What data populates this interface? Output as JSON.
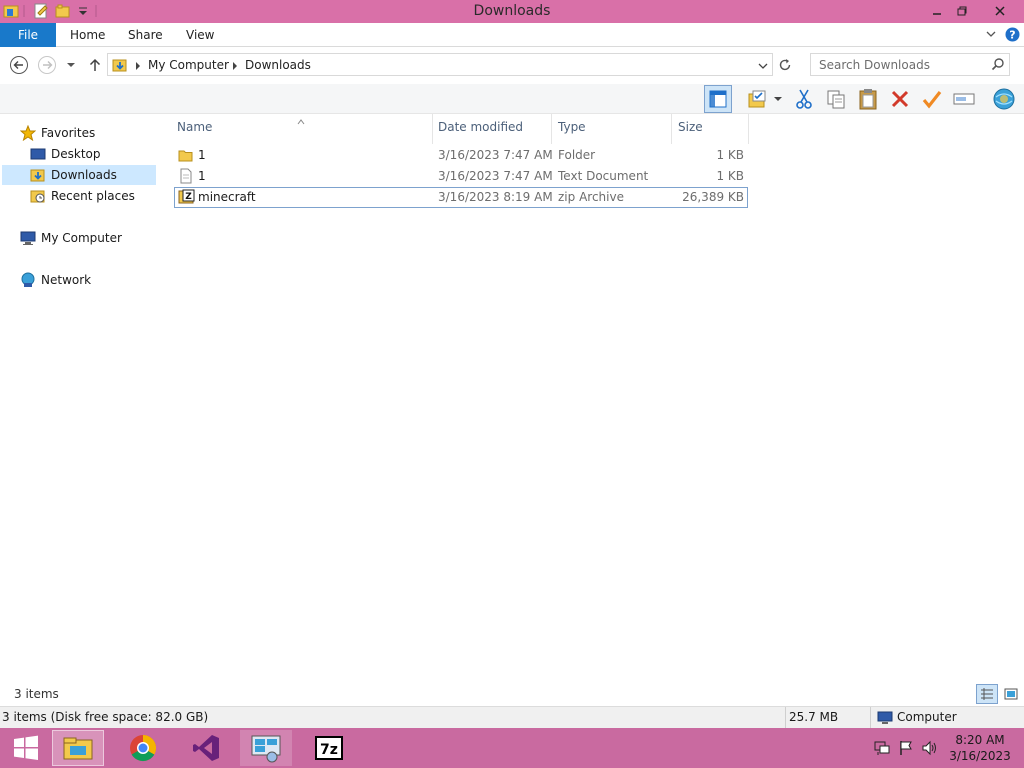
{
  "window": {
    "title": "Downloads"
  },
  "ribbon": {
    "tabs": [
      "File",
      "Home",
      "Share",
      "View"
    ]
  },
  "address": {
    "crumbs": [
      "My Computer",
      "Downloads"
    ],
    "search_placeholder": "Search Downloads"
  },
  "navpane": {
    "items": [
      {
        "label": "Favorites",
        "icon": "star-icon"
      },
      {
        "label": "Desktop",
        "icon": "desktop-icon"
      },
      {
        "label": "Downloads",
        "icon": "downloads-folder-icon",
        "selected": true
      },
      {
        "label": "Recent places",
        "icon": "recent-places-icon"
      },
      {
        "label": "My Computer",
        "icon": "computer-icon"
      },
      {
        "label": "Network",
        "icon": "network-icon"
      }
    ]
  },
  "columns": [
    "Name",
    "Date modified",
    "Type",
    "Size"
  ],
  "files": [
    {
      "name": "1",
      "date": "3/16/2023 7:47 AM",
      "type": "Folder",
      "size": "1 KB",
      "icon": "folder-icon"
    },
    {
      "name": "1",
      "date": "3/16/2023 7:47 AM",
      "type": "Text Document",
      "size": "1 KB",
      "icon": "text-file-icon"
    },
    {
      "name": "minecraft",
      "date": "3/16/2023 8:19 AM",
      "type": "zip Archive",
      "size": "26,389 KB",
      "icon": "zip-archive-icon",
      "selected": true
    }
  ],
  "status": {
    "item_count": "3 items",
    "summary": "3 items (Disk free space: 82.0 GB)",
    "size": "25.7 MB",
    "location": "Computer"
  },
  "taskbar": {
    "apps": [
      "file-explorer",
      "chrome",
      "visual-studio",
      "remote-desktop",
      "7-zip"
    ],
    "time": "8:20 AM",
    "date": "3/16/2023"
  },
  "colors": {
    "titlebar": "#d970a8",
    "taskbar": "#c96aa0",
    "file_tab": "#1979ca",
    "selection_border": "#7da2ce",
    "nav_selected": "#cde8ff"
  }
}
